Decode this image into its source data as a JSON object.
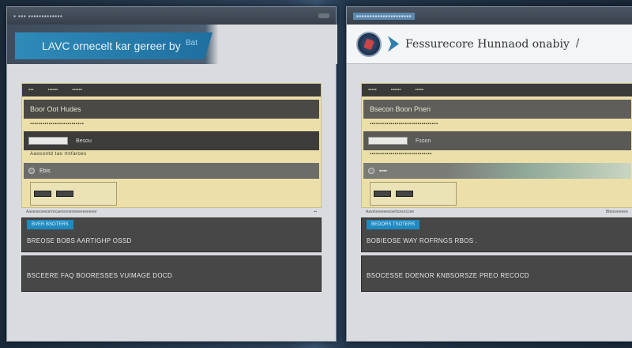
{
  "left_window": {
    "titlebar": "▪  ▪▪▪  ▪▪▪▪▪▪▪▪▪▪▪▪▪",
    "banner_title": "LAVC ornecelt kar gereer by",
    "banner_sub": "Bat",
    "form_header": [
      "▪▪▪",
      "▪▪▪▪▪▪",
      "▪▪▪▪▪▪"
    ],
    "row1": "Boor Oot Hudes",
    "label1": "▪▪▪▪▪▪▪▪▪▪▪▪▪▪▪▪▪▪▪▪▪▪▪▪▪▪",
    "field1": "Besou",
    "label2": "Aaosontd tao rtnfaroes",
    "select1": "Ebis",
    "meta_left": "Aaveoeoeeserrecaeoreoeneeeeeeeeeer",
    "meta_right": "▪▪",
    "panel1_tag": "BVER BSOTERS",
    "panel1_text": "BREOSE BOBS AARTIGHP OSSD",
    "panel2_text": "BSCEERE FAQ BOORESSES VUIMAGE DOCD"
  },
  "right_window": {
    "titlebar": "▪▪▪▪▪▪▪▪▪▪▪▪▪▪▪▪▪▪▪▪▪",
    "banner_title": "Fessurecore Hunnaod onabiy",
    "banner_slash": "/",
    "form_header": [
      "▪▪▪▪▪",
      "▪▪▪▪▪▪",
      "▪▪▪▪▪"
    ],
    "row1": "Bsecon Boon Pnen",
    "label1": "▪▪▪▪▪▪▪▪▪▪▪▪▪▪▪▪▪▪▪▪▪▪▪▪▪▪▪▪▪▪▪▪▪",
    "field1": "Fsoon",
    "label2": "▪▪▪▪▪▪▪▪▪▪▪▪▪▪▪▪▪▪▪▪▪▪▪▪▪▪▪▪▪▪",
    "select1": "▪▪▪▪",
    "meta_left": "Aaveoeeeeeeoerbceurccee",
    "meta_right": "Bbeceeeeee",
    "panel1_tag": "BEDORS TSOTERS",
    "panel1_text": "BOBIEOSE WAY ROFRNGS RBOS .",
    "panel2_text": "BSOCESSE DOENOR KNBSORSZE PREO RECOCD"
  }
}
